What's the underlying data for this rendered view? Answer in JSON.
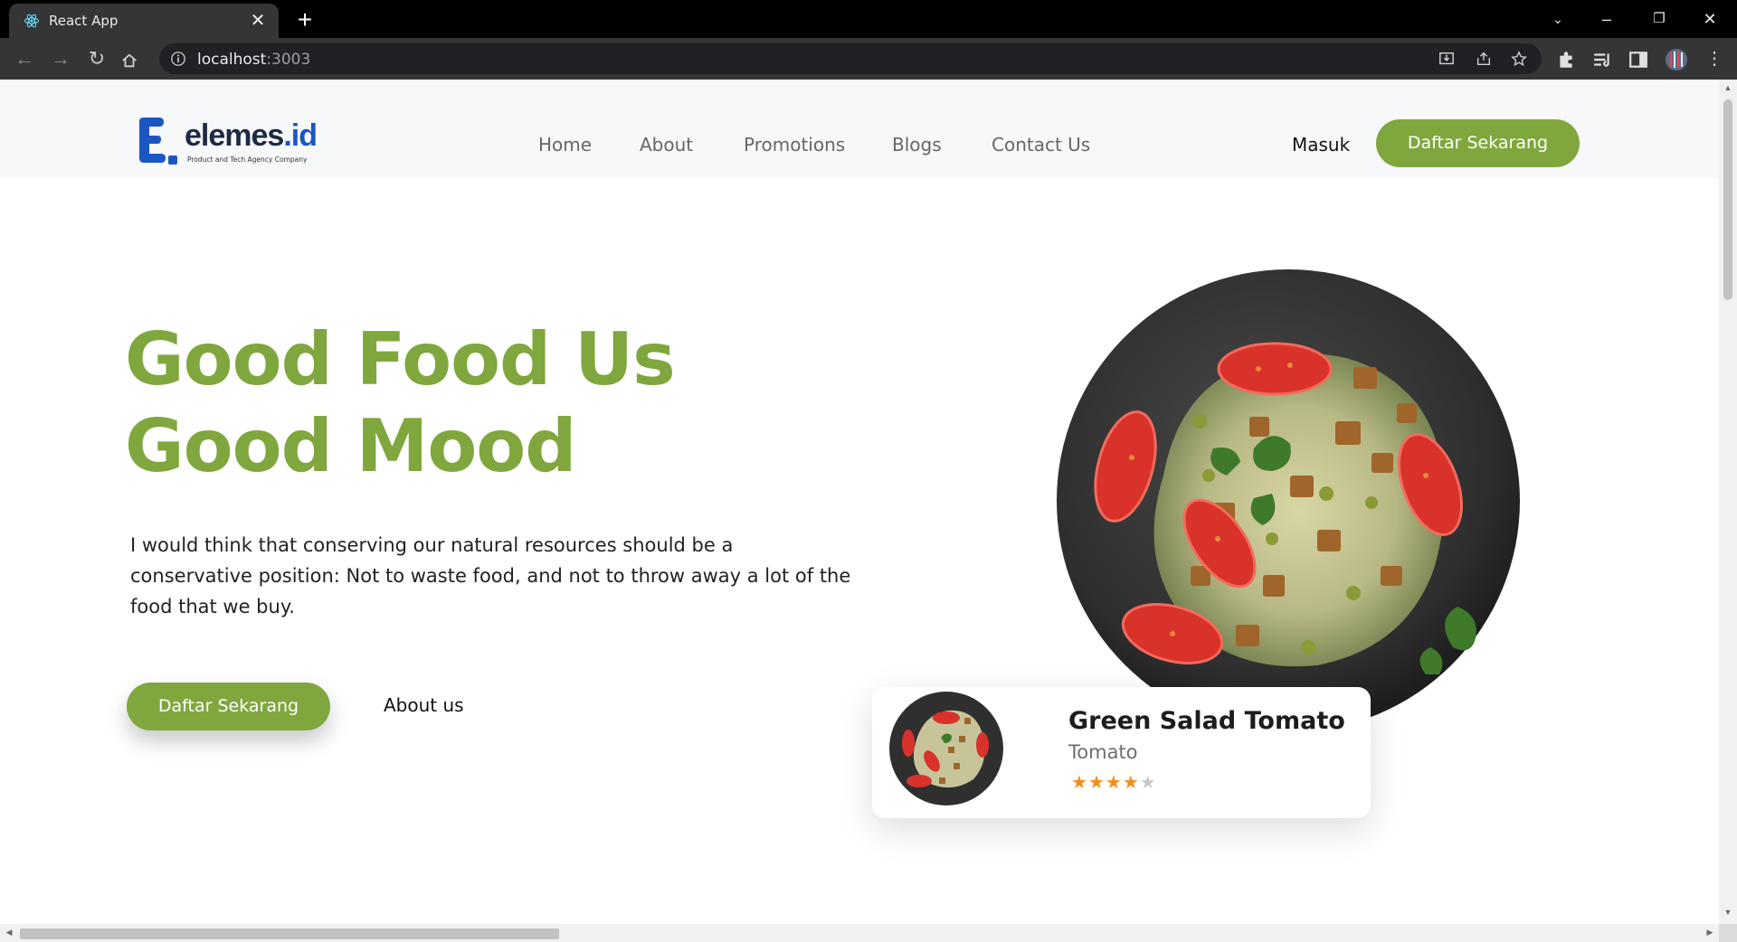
{
  "browser": {
    "tab_title": "React App",
    "url_host": "localhost",
    "url_port": ":3003"
  },
  "site": {
    "logo_text": "elemes",
    "logo_suffix": ".id",
    "logo_tagline": "Product and Tech Agency Company",
    "nav": [
      "Home",
      "About",
      "Promotions",
      "Blogs",
      "Contact Us"
    ],
    "login_label": "Masuk",
    "cta_label": "Daftar Sekarang"
  },
  "hero": {
    "title_line1": "Good Food Us",
    "title_line2": "Good Mood",
    "paragraph": "I would think that conserving our natural resources should be a conservative position: Not to waste food, and not to throw away a lot of the food that we buy.",
    "primary_button": "Daftar Sekarang",
    "secondary_link": "About us"
  },
  "product_card": {
    "title": "Green Salad Tomato",
    "subtitle": "Tomato",
    "rating": 4,
    "rating_max": 5
  },
  "colors": {
    "brand_green": "#7fa73d",
    "star_orange": "#f28c1a",
    "logo_blue": "#1a56c4"
  }
}
